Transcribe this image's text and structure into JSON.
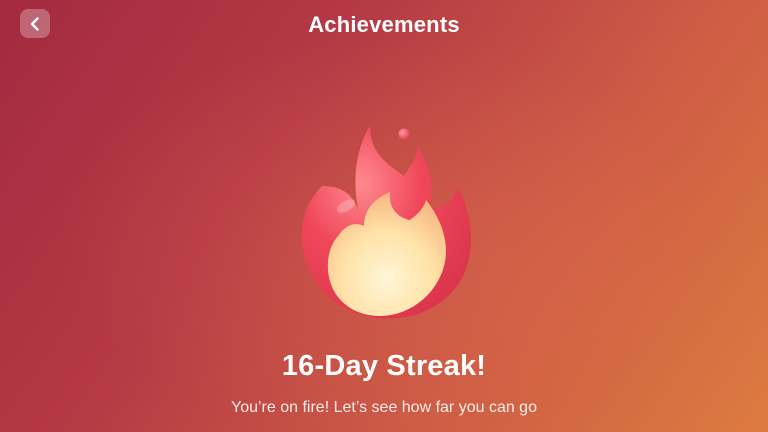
{
  "header": {
    "back_icon": "chevron-left-icon",
    "title": "Achievements"
  },
  "achievement": {
    "icon": "flame-icon",
    "streak_days": 16,
    "title": "16-Day Streak!",
    "message": "You’re on fire! Let’s see how far you can go"
  },
  "colors": {
    "background_start": "#a32a40",
    "background_end": "#dd7b40",
    "flame_outer": "#f0475a",
    "flame_inner": "#ffe7b0",
    "text": "#ffffff"
  }
}
